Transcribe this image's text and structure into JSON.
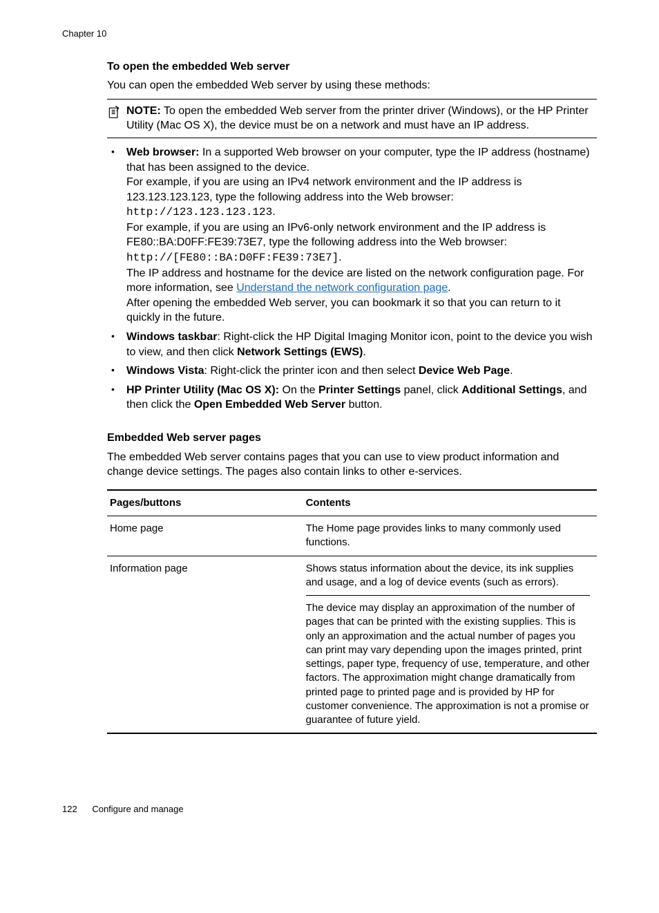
{
  "chapter_label": "Chapter 10",
  "section1_heading": "To open the embedded Web server",
  "section1_intro": "You can open the embedded Web server by using these methods:",
  "note": {
    "label": "NOTE:",
    "text": "To open the embedded Web server from the printer driver (Windows), or the HP Printer Utility (Mac OS X), the device must be on a network and must have an IP address."
  },
  "bullets": {
    "b1": {
      "lead": "Web browser:",
      "l1": " In a supported Web browser on your computer, type the IP address (hostname) that has been assigned to the device.",
      "l2a": "For example, if you are using an IPv4 network environment and the IP address is 123.123.123.123, type the following address into the Web browser: ",
      "l2code": "http://123.123.123.123",
      "l2b": ".",
      "l3a": "For example, if you are using an IPv6-only network environment and the IP address is FE80::BA:D0FF:FE39:73E7, type the following address into the Web browser: ",
      "l3code": "http://[FE80::BA:D0FF:FE39:73E7]",
      "l3b": ".",
      "l4a": "The IP address and hostname for the device are listed on the network configuration page. For more information, see ",
      "l4link": "Understand the network configuration page",
      "l4b": ".",
      "l5": "After opening the embedded Web server, you can bookmark it so that you can return to it quickly in the future."
    },
    "b2": {
      "lead": "Windows taskbar",
      "t1": ": Right-click the HP Digital Imaging Monitor icon, point to the device you wish to view, and then click ",
      "bold1": "Network Settings (EWS)",
      "t2": "."
    },
    "b3": {
      "lead": "Windows Vista",
      "t1": ": Right-click the printer icon and then select ",
      "bold1": "Device Web Page",
      "t2": "."
    },
    "b4": {
      "lead": "HP Printer Utility (Mac OS X):",
      "t1": " On the ",
      "bold1": "Printer Settings",
      "t2": " panel, click ",
      "bold2": "Additional Settings",
      "t3": ", and then click the ",
      "bold3": "Open Embedded Web Server",
      "t4": " button."
    }
  },
  "section2_heading": "Embedded Web server pages",
  "section2_intro": "The embedded Web server contains pages that you can use to view product information and change device settings. The pages also contain links to other e-services.",
  "table": {
    "h1": "Pages/buttons",
    "h2": "Contents",
    "r1c1": "Home page",
    "r1c2": "The Home page provides links to many commonly used functions.",
    "r2c1": "Information page",
    "r2c2a": "Shows status information about the device, its ink supplies and usage, and a log of device events (such as errors).",
    "r2c2b": "The device may display an approximation of the number of pages that can be printed with the existing supplies. This is only an approximation and the actual number of pages you can print may vary depending upon the images printed, print settings, paper type, frequency of use, temperature, and other factors. The approximation might change dramatically from printed page to printed page and is provided by HP for customer convenience. The approximation is not a promise or guarantee of future yield."
  },
  "footer": {
    "page": "122",
    "title": "Configure and manage"
  }
}
